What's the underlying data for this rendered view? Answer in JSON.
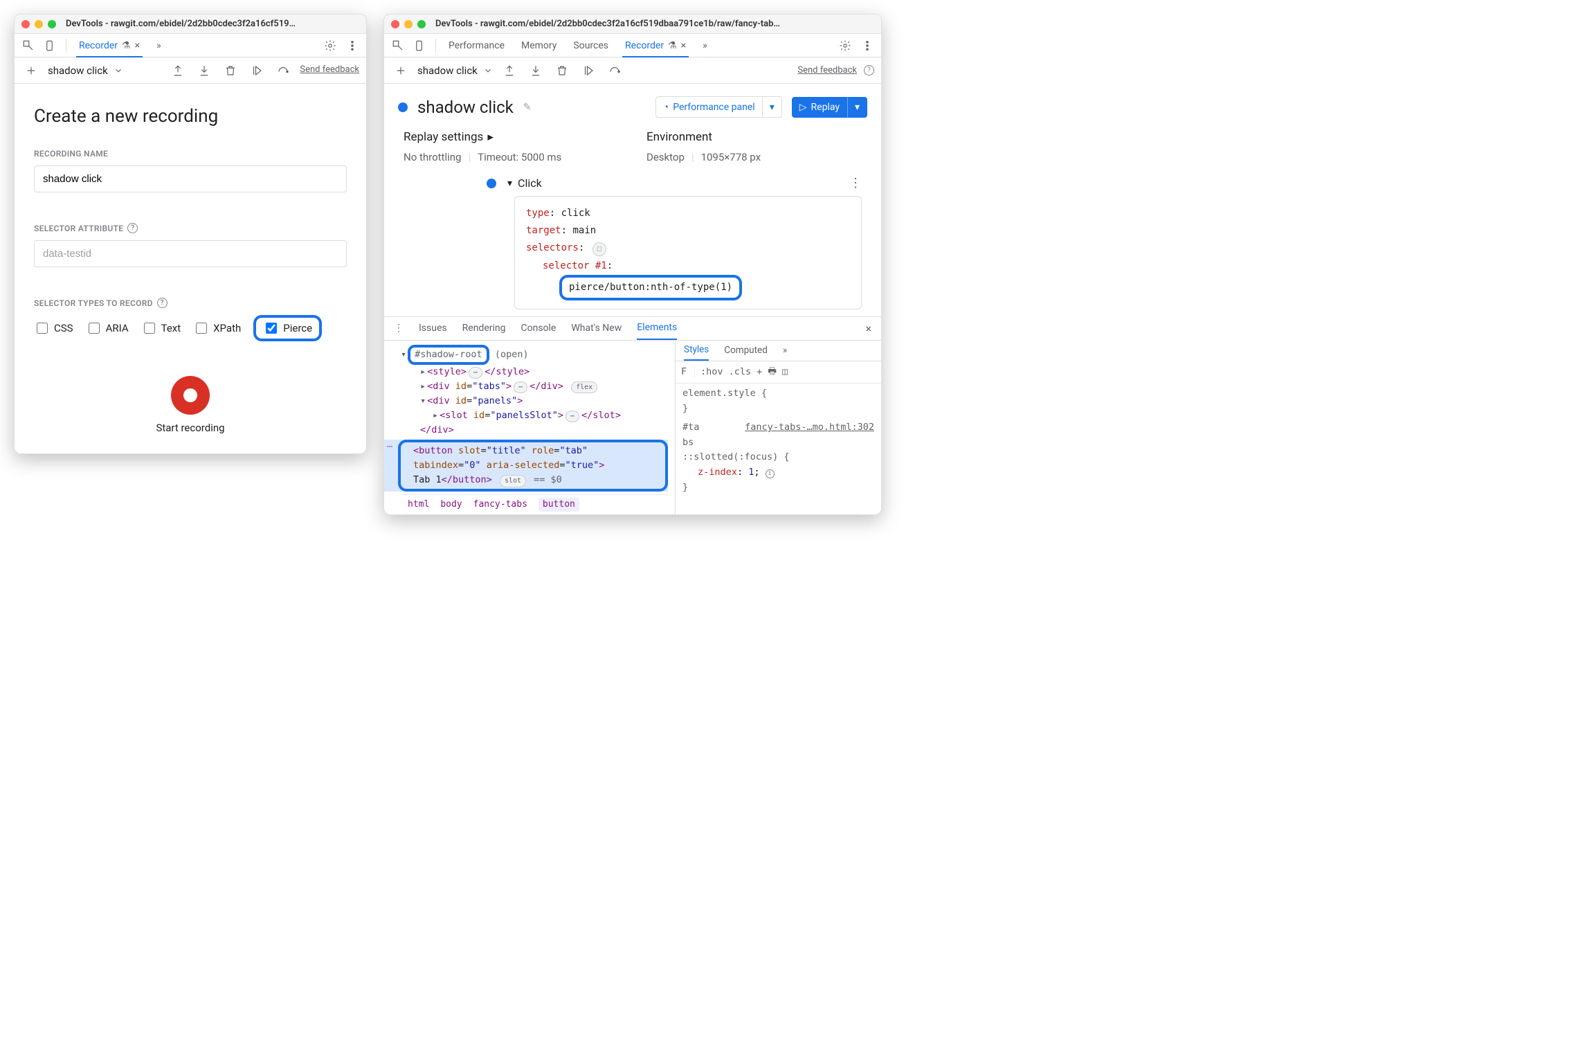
{
  "left": {
    "title": "DevTools - rawgit.com/ebidel/2d2bb0cdec3f2a16cf519…",
    "tab_recorder": "Recorder",
    "more_tabs": "»",
    "recording_dropdown": "shadow click",
    "send_feedback": "Send feedback",
    "heading": "Create a new recording",
    "label_recording_name": "RECORDING NAME",
    "recording_name_value": "shadow click",
    "label_selector_attr": "SELECTOR ATTRIBUTE",
    "selector_attr_placeholder": "data-testid",
    "label_selector_types": "SELECTOR TYPES TO RECORD",
    "types": {
      "css": "CSS",
      "aria": "ARIA",
      "text": "Text",
      "xpath": "XPath",
      "pierce": "Pierce"
    },
    "start_recording": "Start recording"
  },
  "right": {
    "title": "DevTools - rawgit.com/ebidel/2d2bb0cdec3f2a16cf519dbaa791ce1b/raw/fancy-tab…",
    "tabs": {
      "performance": "Performance",
      "memory": "Memory",
      "sources": "Sources",
      "recorder": "Recorder"
    },
    "more_tabs": "»",
    "recording_dropdown": "shadow click",
    "send_feedback": "Send feedback",
    "panel_title": "shadow click",
    "perf_panel_btn": "Performance panel",
    "replay_btn": "Replay",
    "replay_settings": "Replay settings",
    "throttle": "No throttling",
    "timeout": "Timeout: 5000 ms",
    "env_title": "Environment",
    "env_device": "Desktop",
    "env_viewport": "1095×778 px",
    "step_name": "Click",
    "step": {
      "type_k": "type",
      "type_v": "click",
      "target_k": "target",
      "target_v": "main",
      "selectors_k": "selectors",
      "sel1_k": "selector #1",
      "sel1_v": "pierce/button:nth-of-type(1)"
    },
    "drawer_tabs": {
      "issues": "Issues",
      "rendering": "Rendering",
      "console": "Console",
      "whatsnew": "What's New",
      "elements": "Elements"
    },
    "dom": {
      "shadow_root": "#shadow-root",
      "shadow_open": "(open)",
      "style_tag": "<style>…</style>",
      "tabs_div_open": "<div id=\"tabs\">",
      "flex_badge": "flex",
      "panels_div_open": "<div id=\"panels\">",
      "slot_open": "<slot id=\"panelsSlot\">",
      "div_close": "</div>",
      "slot_close": "</slot>",
      "button_line1": "<button slot=\"title\" role=\"tab\"",
      "button_line2": "tabindex=\"0\" aria-selected=\"true\">",
      "button_text": "Tab 1",
      "button_close": "</button>",
      "slot_badge": "slot",
      "eq0": " == $0"
    },
    "crumbs": [
      "html",
      "body",
      "fancy-tabs",
      "button"
    ],
    "styles_tabs": {
      "styles": "Styles",
      "computed": "Computed",
      "more": "»"
    },
    "filter_f": "F",
    "hov": ":hov",
    "cls": ".cls",
    "element_style": "element.style {",
    "brace_close": "}",
    "rule_sel": "#tabs",
    "rule_src": "fancy-tabs-…mo.html:302",
    "slotted": "::slotted(:focus) {",
    "zindex_k": "z-index",
    "zindex_v": "1"
  }
}
